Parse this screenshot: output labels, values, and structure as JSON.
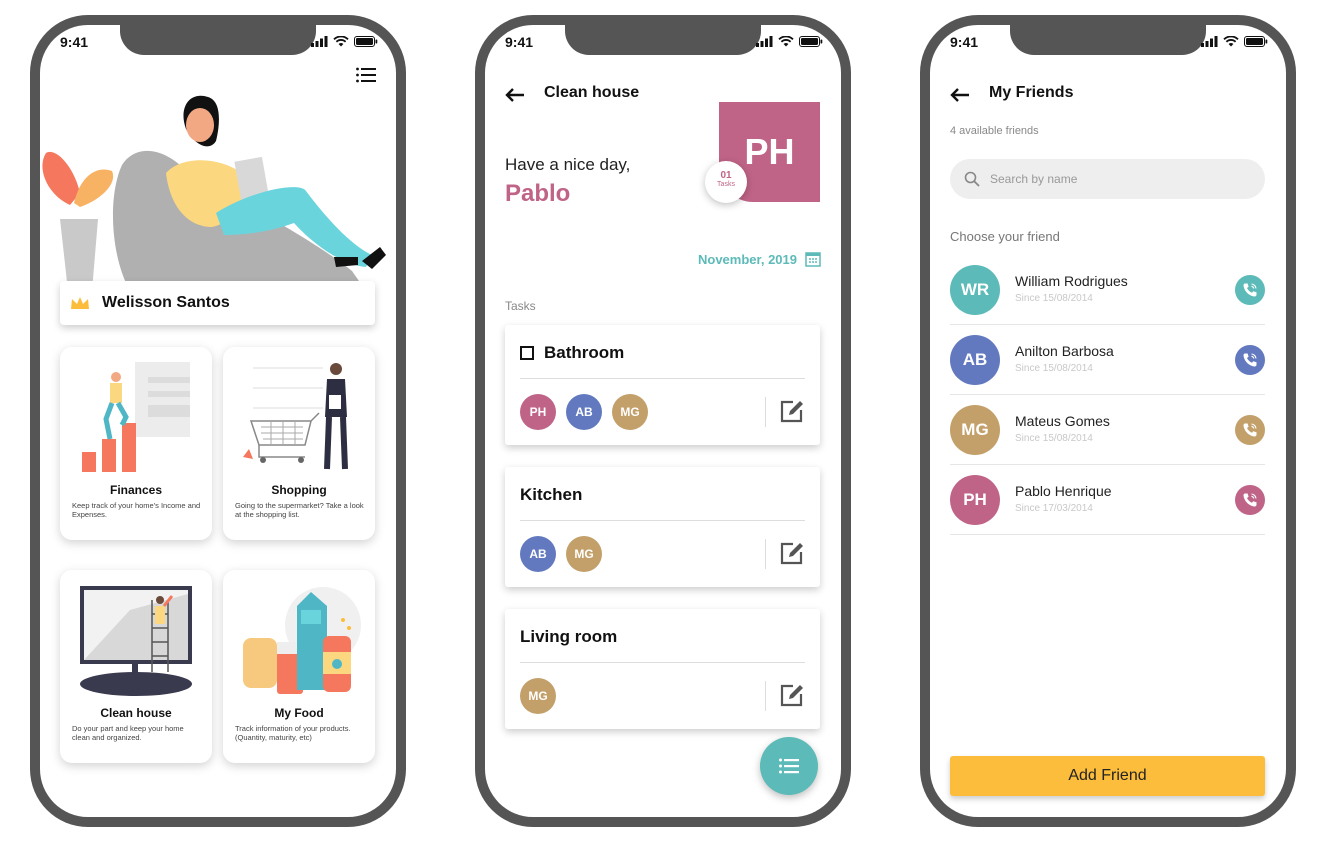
{
  "status_bar": {
    "time": "9:41"
  },
  "colors": {
    "pink": "#c06487",
    "blue": "#6279bf",
    "gold": "#c3a06a",
    "teal": "#5cbab8",
    "accent_yellow": "#fbbd3b",
    "coral": "#f5775d"
  },
  "home": {
    "user_name": "Welisson Santos",
    "tiles": [
      {
        "title": "Finances",
        "description": "Keep track of your home's Income and Expenses."
      },
      {
        "title": "Shopping",
        "description": "Going to the supermarket? Take a look at the shopping list."
      },
      {
        "title": "Clean house",
        "description": "Do your part and keep your home clean and organized."
      },
      {
        "title": "My Food",
        "description": "Track information of your products. (Quantity, maturity, etc)"
      }
    ]
  },
  "clean_house": {
    "title": "Clean house",
    "greeting": "Have a nice day,",
    "user_first_name": "Pablo",
    "avatar_initials": "PH",
    "task_count": "01",
    "task_count_label": "Tasks",
    "date": "November, 2019",
    "section_label": "Tasks",
    "tasks": [
      {
        "name": "Bathroom",
        "assignees": [
          "PH",
          "AB",
          "MG"
        ]
      },
      {
        "name": "Kitchen",
        "assignees": [
          "AB",
          "MG"
        ]
      },
      {
        "name": "Living room",
        "assignees": [
          "MG"
        ]
      }
    ]
  },
  "friends": {
    "title": "My Friends",
    "available_count": "4 available friends",
    "search_placeholder": "Search by name",
    "choose_label": "Choose your friend",
    "list": [
      {
        "initials": "WR",
        "name": "William Rodrigues",
        "since": "Since 15/08/2014",
        "color": "#5cbab8"
      },
      {
        "initials": "AB",
        "name": "Anilton Barbosa",
        "since": "Since 15/08/2014",
        "color": "#6279bf"
      },
      {
        "initials": "MG",
        "name": "Mateus Gomes",
        "since": "Since 15/08/2014",
        "color": "#c3a06a"
      },
      {
        "initials": "PH",
        "name": "Pablo Henrique",
        "since": "Since 17/03/2014",
        "color": "#c06487"
      }
    ],
    "add_button": "Add Friend"
  }
}
